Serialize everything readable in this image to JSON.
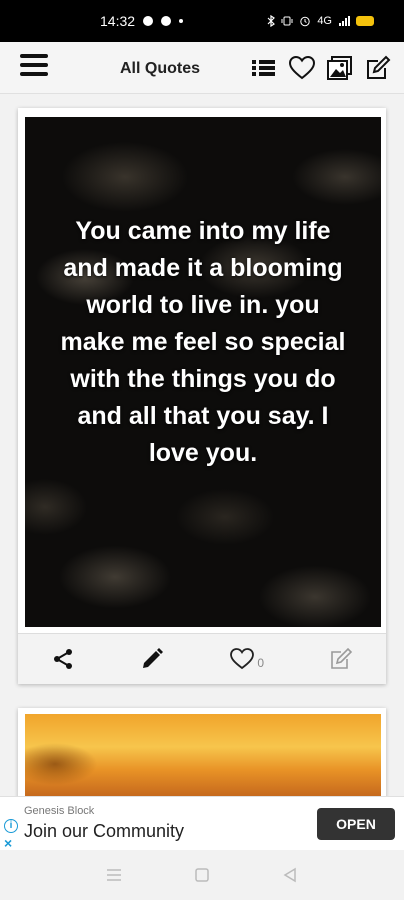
{
  "status_bar": {
    "time": "14:32",
    "network_label": "4G"
  },
  "app_bar": {
    "title": "All Quotes",
    "icons": [
      "menu-icon",
      "list-icon",
      "heart-icon",
      "gallery-icon",
      "edit-icon"
    ]
  },
  "quote_card": {
    "text": "You came into my life and made it a blooming world to live in. you make me feel so special with the things you do and all that you say. I love you.",
    "like_count": "0",
    "actions": [
      "share-icon",
      "pencil-icon",
      "heart-outline-icon",
      "edit-note-icon"
    ]
  },
  "ad": {
    "brand": "Genesis Block",
    "headline": "Join our Community",
    "cta": "OPEN"
  },
  "colors": {
    "status_bar_bg": "#000000",
    "app_bar_bg": "#f5f5f5",
    "battery": "#f4c20d",
    "ad_accent": "#1a9ad6",
    "ad_button": "#333333"
  }
}
